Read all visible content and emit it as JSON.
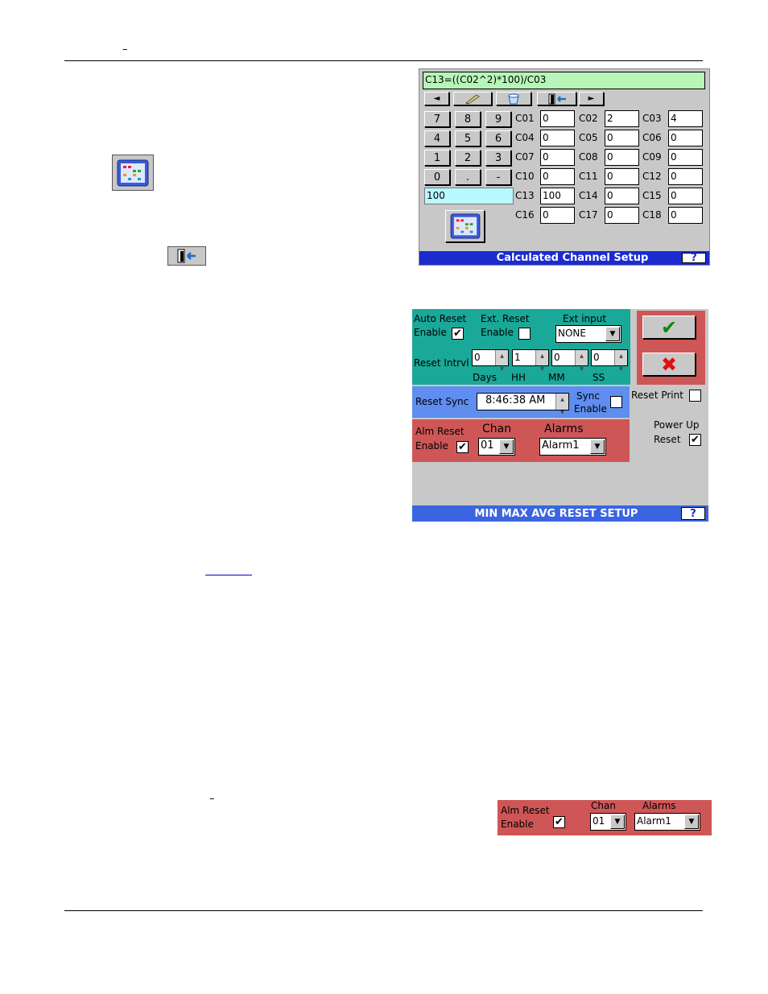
{
  "header": {
    "dash": "–"
  },
  "calc": {
    "formula": "C13=((C02^2)*100)/C03",
    "arrow_left": "◄",
    "arrow_right": "►",
    "keypad": [
      "7",
      "8",
      "9",
      "4",
      "5",
      "6",
      "1",
      "2",
      "3",
      "0",
      ".",
      "-"
    ],
    "entry_value": "100",
    "channels": [
      {
        "label": "C01",
        "value": "0"
      },
      {
        "label": "C02",
        "value": "2"
      },
      {
        "label": "C03",
        "value": "4"
      },
      {
        "label": "C04",
        "value": "0"
      },
      {
        "label": "C05",
        "value": "0"
      },
      {
        "label": "C06",
        "value": "0"
      },
      {
        "label": "C07",
        "value": "0"
      },
      {
        "label": "C08",
        "value": "0"
      },
      {
        "label": "C09",
        "value": "0"
      },
      {
        "label": "C10",
        "value": "0"
      },
      {
        "label": "C11",
        "value": "0"
      },
      {
        "label": "C12",
        "value": "0"
      },
      {
        "label": "C13",
        "value": "100"
      },
      {
        "label": "C14",
        "value": "0"
      },
      {
        "label": "C15",
        "value": "0"
      },
      {
        "label": "C16",
        "value": "0"
      },
      {
        "label": "C17",
        "value": "0"
      },
      {
        "label": "C18",
        "value": "0"
      }
    ],
    "title": "Calculated Channel Setup",
    "help": "?"
  },
  "reset": {
    "auto_reset_label1": "Auto Reset",
    "auto_reset_label2": "Enable",
    "ext_reset_label1": "Ext. Reset",
    "ext_reset_label2": "Enable",
    "ext_input_label": "Ext input",
    "ext_input_value": "NONE",
    "reset_intrvl_label": "Reset Intrvl",
    "intervals": [
      {
        "value": "0",
        "unit": "Days"
      },
      {
        "value": "1",
        "unit": "HH"
      },
      {
        "value": "0",
        "unit": "MM"
      },
      {
        "value": "0",
        "unit": "SS"
      }
    ],
    "reset_sync_label": "Reset Sync",
    "reset_sync_time": "8:46:38 AM",
    "sync_enable_label1": "Sync",
    "sync_enable_label2": "Enable",
    "reset_print_label": "Reset Print",
    "alm_reset_label1": "Alm Reset",
    "alm_reset_label2": "Enable",
    "chan_label": "Chan",
    "chan_value": "01",
    "alarms_label": "Alarms",
    "alarms_value": "Alarm1",
    "power_up_label1": "Power Up",
    "power_up_label2": "Reset",
    "check_mark": "✔",
    "ok_mark": "✔",
    "cancel_mark": "✖",
    "title": "MIN MAX AVG RESET SETUP",
    "help": "?"
  },
  "snippet": {
    "dash": "–",
    "alm_reset_label1": "Alm Reset",
    "alm_reset_label2": "Enable",
    "chan_label": "Chan",
    "chan_value": "01",
    "alarms_label": "Alarms",
    "alarms_value": "Alarm1",
    "check_mark": "✔"
  }
}
